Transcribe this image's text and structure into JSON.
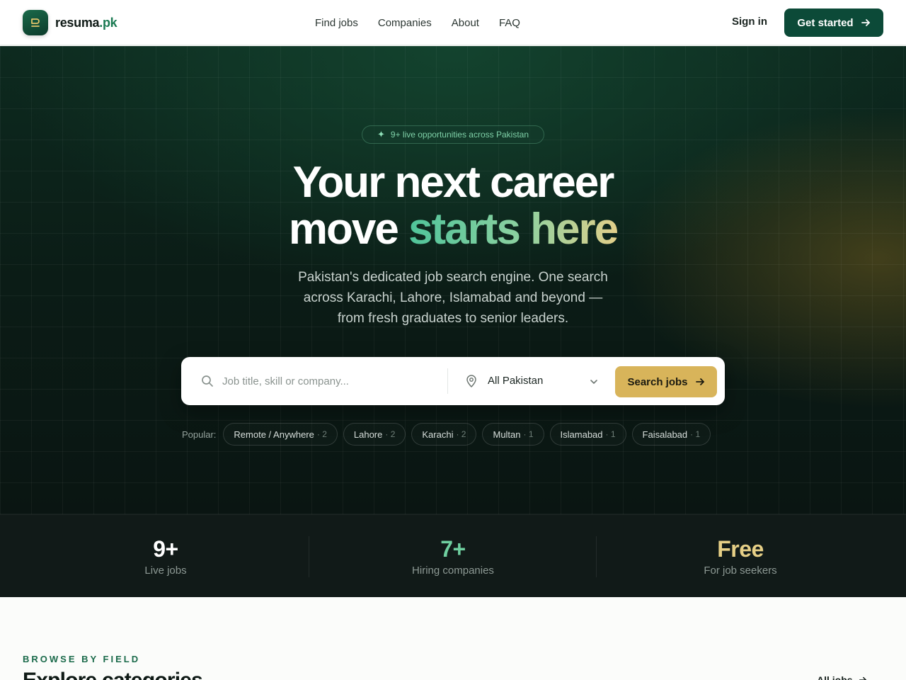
{
  "brand": {
    "name": "resuma",
    "tld": ".pk"
  },
  "nav": {
    "links": [
      "Find jobs",
      "Companies",
      "About",
      "FAQ"
    ],
    "signin": "Sign in",
    "cta": "Get started"
  },
  "hero": {
    "pill": "9+ live opportunities across Pakistan",
    "headline_line1": "Your next career",
    "headline_line2_plain": "move ",
    "headline_line2_accent": "starts here",
    "subtitle": "Pakistan's dedicated job search engine. One search across Karachi, Lahore, Islamabad and beyond — from fresh graduates to senior leaders."
  },
  "search": {
    "placeholder": "Job title, skill or company...",
    "location": "All Pakistan",
    "button": "Search jobs"
  },
  "popular": {
    "label": "Popular:",
    "chips": [
      {
        "label": "Remote / Anywhere",
        "count": "· 2"
      },
      {
        "label": "Lahore",
        "count": "· 2"
      },
      {
        "label": "Karachi",
        "count": "· 2"
      },
      {
        "label": "Multan",
        "count": "· 1"
      },
      {
        "label": "Islamabad",
        "count": "· 1"
      },
      {
        "label": "Faisalabad",
        "count": "· 1"
      }
    ]
  },
  "stats": [
    {
      "value": "9+",
      "label": "Live jobs",
      "color": "#ffffff"
    },
    {
      "value": "7+",
      "label": "Hiring companies",
      "color": "#6fcf9f"
    },
    {
      "value": "Free",
      "label": "For job seekers",
      "color": "#e6cf86"
    }
  ],
  "section": {
    "eyebrow": "BROWSE BY FIELD",
    "title": "Explore categories",
    "all_link": "All jobs"
  },
  "colors": {
    "primary": "#0c4a38",
    "accent_gold": "#d8b45a",
    "accent_green": "#4fc49a"
  }
}
